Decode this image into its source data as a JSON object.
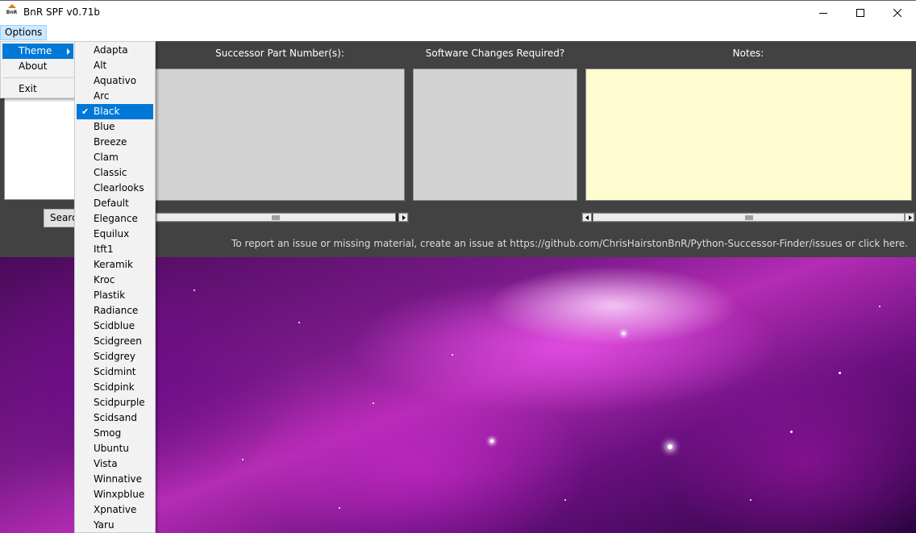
{
  "window": {
    "title": "BnR SPF v0.71b",
    "icon_text": "BnR"
  },
  "menubar": {
    "options_label": "Options"
  },
  "options_menu": {
    "theme_label": "Theme",
    "about_label": "About",
    "exit_label": "Exit"
  },
  "theme_menu": {
    "selected": "Black",
    "items": [
      "Adapta",
      "Alt",
      "Aquativo",
      "Arc",
      "Black",
      "Blue",
      "Breeze",
      "Clam",
      "Classic",
      "Clearlooks",
      "Default",
      "Elegance",
      "Equilux",
      "Itft1",
      "Keramik",
      "Kroc",
      "Plastik",
      "Radiance",
      "Scidblue",
      "Scidgreen",
      "Scidgrey",
      "Scidmint",
      "Scidpink",
      "Scidpurple",
      "Scidsand",
      "Smog",
      "Ubuntu",
      "Vista",
      "Winnative",
      "Winxpblue",
      "Xpnative",
      "Yaru"
    ]
  },
  "main": {
    "headers": {
      "successor": "Successor Part Number(s):",
      "software": "Software Changes Required?",
      "notes": "Notes:"
    },
    "search_label": "Search",
    "report_text": "To report an issue or missing material, create an issue at https://github.com/ChrisHairstonBnR/Python-Successor-Finder/issues or click here."
  },
  "colors": {
    "panel_bg": "#424242",
    "textbox_grey": "#d3d3d3",
    "notes_bg": "#fffcd0",
    "highlight": "#0078d7"
  }
}
